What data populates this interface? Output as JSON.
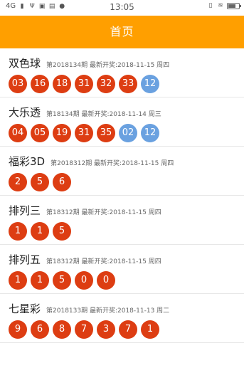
{
  "status_bar": {
    "network": "4G",
    "time": "13:05"
  },
  "header": {
    "title": "首页"
  },
  "colors": {
    "brand": "#ff9f00",
    "red_ball": "#dd3d12",
    "blue_ball": "#6aa1e0"
  },
  "lotteries": [
    {
      "name": "双色球",
      "issue_info": "第2018134期 最新开奖:2018-11-15 周四",
      "red": [
        "03",
        "16",
        "18",
        "31",
        "32",
        "33"
      ],
      "blue": [
        "12"
      ]
    },
    {
      "name": "大乐透",
      "issue_info": "第18134期 最新开奖:2018-11-14 周三",
      "red": [
        "04",
        "05",
        "19",
        "31",
        "35"
      ],
      "blue": [
        "02",
        "12"
      ]
    },
    {
      "name": "福彩3D",
      "issue_info": "第2018312期 最新开奖:2018-11-15 周四",
      "red": [
        "2",
        "5",
        "6"
      ],
      "blue": []
    },
    {
      "name": "排列三",
      "issue_info": "第18312期 最新开奖:2018-11-15 周四",
      "red": [
        "1",
        "1",
        "5"
      ],
      "blue": []
    },
    {
      "name": "排列五",
      "issue_info": "第18312期 最新开奖:2018-11-15 周四",
      "red": [
        "1",
        "1",
        "5",
        "0",
        "0"
      ],
      "blue": []
    },
    {
      "name": "七星彩",
      "issue_info": "第2018133期 最新开奖:2018-11-13 周二",
      "red": [
        "9",
        "6",
        "8",
        "7",
        "3",
        "7",
        "1"
      ],
      "blue": []
    }
  ]
}
